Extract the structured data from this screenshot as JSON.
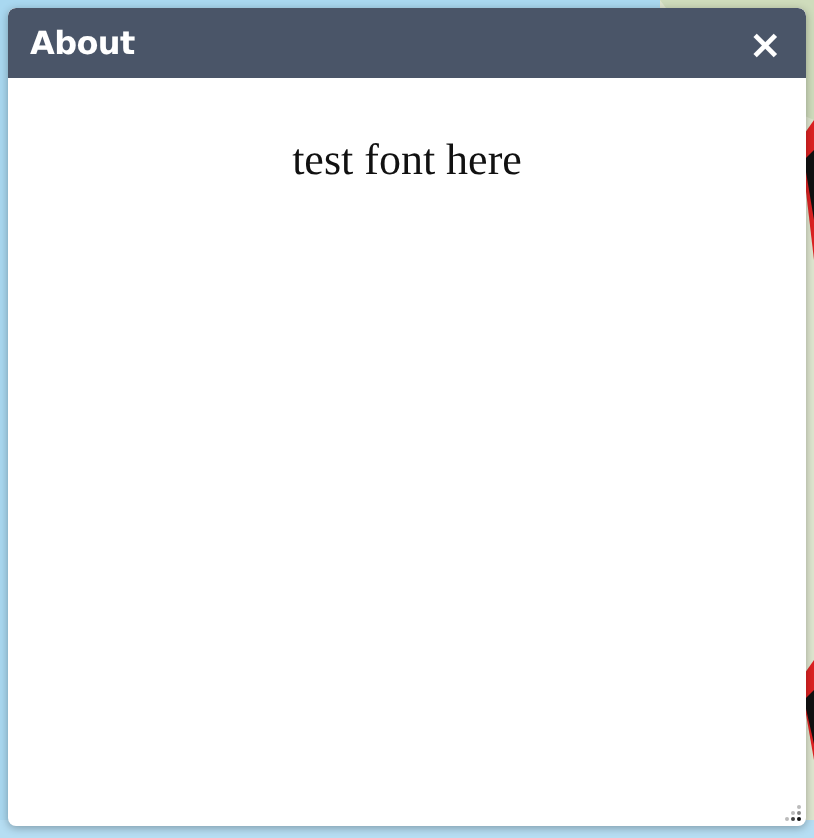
{
  "dialog": {
    "title": "About",
    "close": "×",
    "body": "test font here"
  }
}
